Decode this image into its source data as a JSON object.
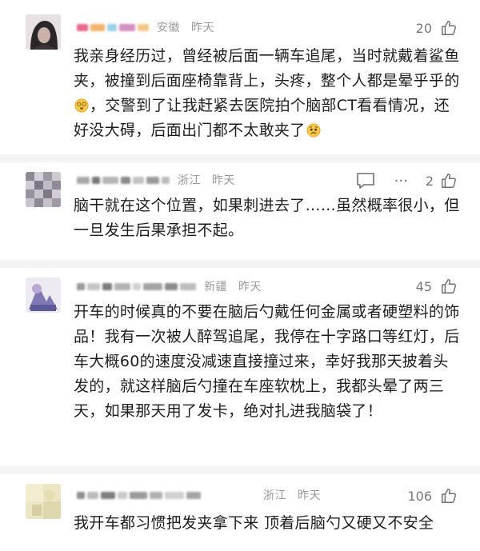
{
  "comments": [
    {
      "region": "安徽",
      "time": "昨天",
      "likes": "20",
      "text_parts": [
        "我亲身经历过，曾经被后面一辆车追尾，当时就戴着鲨鱼夹，被撞到后面座椅靠背上，头疼，整个人都是晕乎乎的",
        "，交警到了让我赶紧去医院拍个脑部CT看看情况，还好没大碍，后面出门都不太敢夹了"
      ],
      "emoji_names": [
        "dizzy-face-emoji",
        "worried-face-emoji"
      ]
    },
    {
      "region": "浙江",
      "time": "昨天",
      "likes": "2",
      "more": "···",
      "text": "脑干就在这个位置，如果刺进去了……虽然概率很小，但一旦发生后果承担不起。"
    },
    {
      "region": "新疆",
      "time": "昨天",
      "likes": "45",
      "text": "开车的时候真的不要在脑后勺戴任何金属或者硬塑料的饰品！我有一次被人醉驾追尾，我停在十字路口等红灯，后车大概60的速度没减速直接撞过来，幸好我那天披着头发的，就这样脑后勺撞在车座软枕上，我都头晕了两三天，如果那天用了发卡，绝对扎进我脑袋了！"
    },
    {
      "region": "浙江",
      "time": "昨天",
      "likes": "106",
      "text": "我开车都习惯把发夹拿下来 顶着后脑勺又硬又不安全"
    }
  ],
  "colors": {
    "meta": "#9a9a9a",
    "text": "#1e1e1e",
    "divider": "#f4f4f4",
    "icon": "#6f6f6f"
  },
  "icons": [
    "thumbs-up-icon",
    "comment-icon",
    "more-icon"
  ]
}
